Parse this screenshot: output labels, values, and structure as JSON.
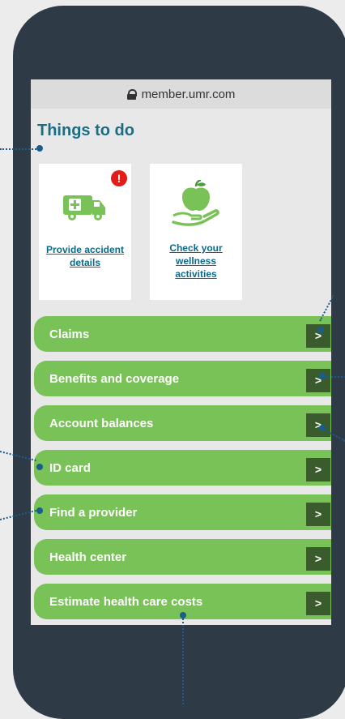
{
  "browser": {
    "url": "member.umr.com"
  },
  "section": {
    "title": "Things to do"
  },
  "cards": [
    {
      "label_line1": "Provide accident",
      "label_line2": "details",
      "alert": "!"
    },
    {
      "label_line1": "Check your",
      "label_line2": "wellness",
      "label_line3": "activities"
    }
  ],
  "menu": [
    {
      "label": "Claims",
      "chevron": ">"
    },
    {
      "label": "Benefits and coverage",
      "chevron": ">"
    },
    {
      "label": "Account balances",
      "chevron": ">"
    },
    {
      "label": "ID card",
      "chevron": ">"
    },
    {
      "label": "Find a provider",
      "chevron": ">"
    },
    {
      "label": "Health center",
      "chevron": ">"
    },
    {
      "label": "Estimate health care costs",
      "chevron": ">"
    }
  ],
  "colors": {
    "brand_green": "#79c257",
    "title_teal": "#1b6d84",
    "callout_blue": "#1b5d8a",
    "phone_frame": "#2e3a45"
  }
}
